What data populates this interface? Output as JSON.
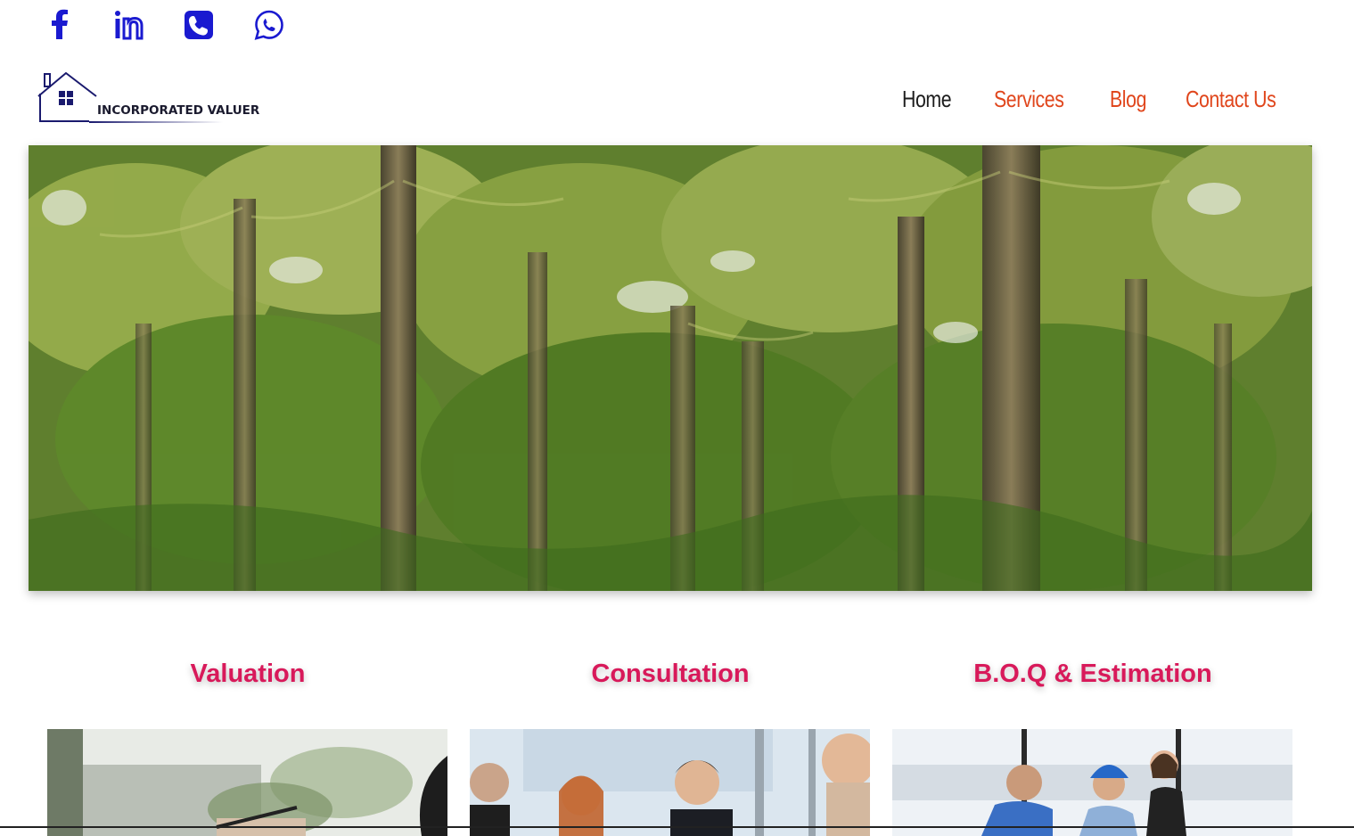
{
  "social": {
    "icons": [
      "facebook-icon",
      "linkedin-icon",
      "phone-icon",
      "whatsapp-icon"
    ],
    "color": "#1a1ad0"
  },
  "logo": {
    "text": "INCORPORATED VALUER",
    "color": "#1a1a6e"
  },
  "nav": {
    "items": [
      {
        "label": "Home",
        "active": true
      },
      {
        "label": "Services",
        "active": false
      },
      {
        "label": "Blog",
        "active": false
      },
      {
        "label": "Contact Us",
        "active": false
      }
    ],
    "accent": "#e0461c"
  },
  "hero": {
    "subject": "palm-plantation-image"
  },
  "services": [
    {
      "title": "Valuation",
      "image": "valuation-photo"
    },
    {
      "title": "Consultation",
      "image": "consultation-photo"
    },
    {
      "title": "B.O.Q & Estimation",
      "image": "estimation-photo"
    }
  ],
  "colors": {
    "service_title": "#d8195a",
    "nav_active": "#1c1c1c"
  }
}
